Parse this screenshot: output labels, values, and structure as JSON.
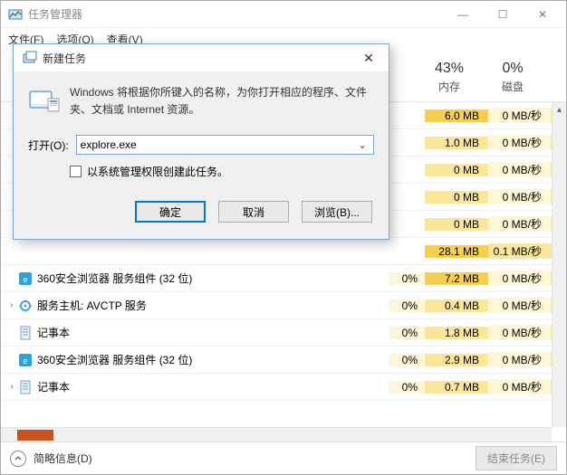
{
  "window": {
    "title": "任务管理器",
    "minimize": "—",
    "maximize": "☐",
    "close": "✕"
  },
  "menu": {
    "file": "文件(F)",
    "options": "选项(O)",
    "view": "查看(V)"
  },
  "header": {
    "memory": {
      "pct": "43%",
      "label": "内存"
    },
    "disk": {
      "pct": "0%",
      "label": "磁盘"
    }
  },
  "rows": [
    {
      "expand": false,
      "icon": "app",
      "name": "",
      "cpu": "",
      "mem": "6.0 MB",
      "mem_hot": true,
      "disk": "0 MB/秒",
      "disk_hot": false
    },
    {
      "expand": false,
      "icon": "app",
      "name": "",
      "cpu": "",
      "mem": "1.0 MB",
      "mem_hot": false,
      "disk": "0 MB/秒",
      "disk_hot": false
    },
    {
      "expand": false,
      "icon": "app",
      "name": "",
      "cpu": "",
      "mem": "0 MB",
      "mem_hot": false,
      "disk": "0 MB/秒",
      "disk_hot": false
    },
    {
      "expand": false,
      "icon": "app",
      "name": "",
      "cpu": "",
      "mem": "0 MB",
      "mem_hot": false,
      "disk": "0 MB/秒",
      "disk_hot": false
    },
    {
      "expand": false,
      "icon": "app",
      "name": "",
      "cpu": "",
      "mem": "0 MB",
      "mem_hot": false,
      "disk": "0 MB/秒",
      "disk_hot": false
    },
    {
      "expand": false,
      "icon": "app",
      "name": "",
      "cpu": "",
      "mem": "28.1 MB",
      "mem_hot": true,
      "disk": "0.1 MB/秒",
      "disk_hot": true
    },
    {
      "expand": false,
      "icon": "360",
      "name": "360安全浏览器 服务组件 (32 位)",
      "cpu": "0%",
      "mem": "7.2 MB",
      "mem_hot": true,
      "disk": "0 MB/秒",
      "disk_hot": false
    },
    {
      "expand": true,
      "icon": "svc",
      "name": "服务主机: AVCTP 服务",
      "cpu": "0%",
      "mem": "0.4 MB",
      "mem_hot": false,
      "disk": "0 MB/秒",
      "disk_hot": false
    },
    {
      "expand": false,
      "icon": "note",
      "name": "记事本",
      "cpu": "0%",
      "mem": "1.8 MB",
      "mem_hot": false,
      "disk": "0 MB/秒",
      "disk_hot": false
    },
    {
      "expand": false,
      "icon": "360",
      "name": "360安全浏览器 服务组件 (32 位)",
      "cpu": "0%",
      "mem": "2.9 MB",
      "mem_hot": false,
      "disk": "0 MB/秒",
      "disk_hot": false
    },
    {
      "expand": true,
      "icon": "note",
      "name": "记事本",
      "cpu": "0%",
      "mem": "0.7 MB",
      "mem_hot": false,
      "disk": "0 MB/秒",
      "disk_hot": false
    }
  ],
  "footer": {
    "details": "简略信息(D)",
    "end_task": "结束任务(E)"
  },
  "dialog": {
    "title": "新建任务",
    "close": "✕",
    "desc": "Windows 将根据你所键入的名称，为你打开相应的程序、文件夹、文档或 Internet 资源。",
    "open_label": "打开(O):",
    "open_value": "explore.exe",
    "admin_label": "以系统管理权限创建此任务。",
    "ok": "确定",
    "cancel": "取消",
    "browse": "浏览(B)..."
  }
}
